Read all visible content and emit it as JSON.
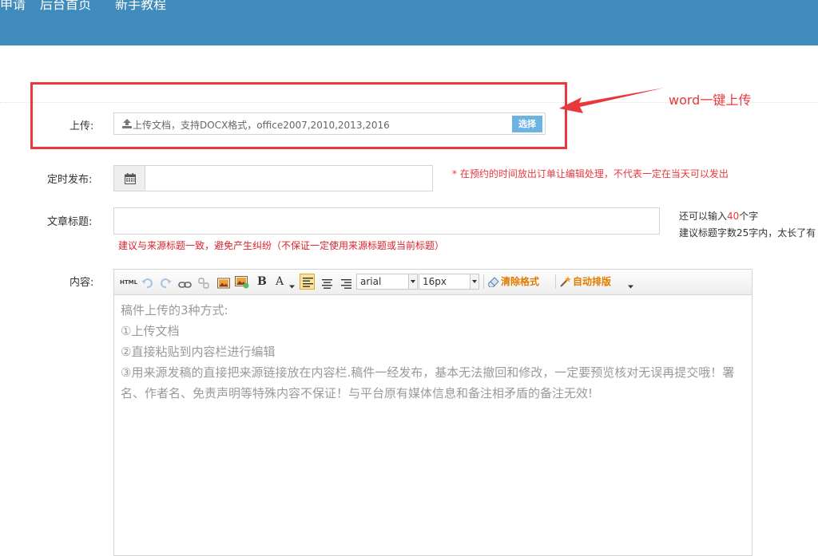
{
  "nav": {
    "items": [
      "申请",
      "后台首页",
      "新手教程"
    ]
  },
  "annotation": {
    "text": "word一键上传",
    "color": "#e8383d"
  },
  "upload": {
    "label": "上传:",
    "placeholder": "上传文档，支持DOCX格式，office2007,2010,2013,2016",
    "button": "选择"
  },
  "schedule": {
    "label": "定时发布:",
    "value": "",
    "note": "* 在预约的时间放出订单让编辑处理，不代表一定在当天可以发出"
  },
  "title_field": {
    "label": "文章标题:",
    "value": "",
    "warning": "建议与来源标题一致，避免产生纠纷（不保证一定使用来源标题或当前标题）",
    "counter_prefix": "还可以输入",
    "counter_value": "40",
    "counter_suffix": "个字",
    "hint": "建议标题字数25字内，太长了有"
  },
  "editor": {
    "label": "内容:",
    "toolbar": {
      "html": "HTML",
      "bold": "B",
      "font_color": "A",
      "font_family": "arial",
      "font_size": "16px",
      "clear_format": "清除格式",
      "auto_layout": "自动排版"
    },
    "content": [
      "稿件上传的3种方式:",
      "①上传文档",
      "②直接粘贴到内容栏进行编辑",
      "③用来源发稿的直接把来源链接放在内容栏.稿件一经发布，基本无法撤回和修改，一定要预览核对无误再提交哦！署名、作者名、免责声明等特殊内容不保证！与平台原有媒体信息和备注相矛盾的备注无效!"
    ]
  },
  "colors": {
    "topbar": "#3f8cbc",
    "annotation_red": "#e8383d",
    "select_button": "#6cb3e2"
  }
}
